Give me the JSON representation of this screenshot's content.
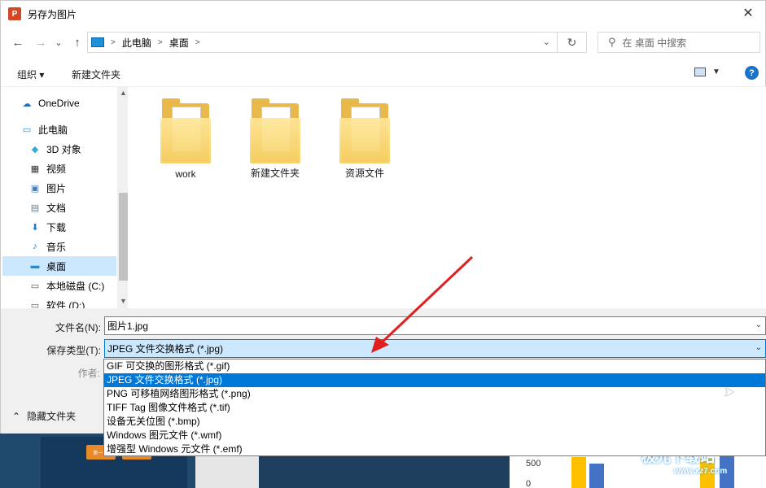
{
  "window": {
    "app_icon": "P",
    "title": "另存为图片",
    "close_icon": "✕"
  },
  "address": {
    "back_icon": "←",
    "forward_icon": "→",
    "history_icon": "⌄",
    "up_icon": "↑",
    "crumbs": [
      "此电脑",
      "桌面"
    ],
    "refresh_icon": "↻",
    "search_placeholder": "在 桌面 中搜索",
    "search_icon": "⚲"
  },
  "toolbar": {
    "organize": "组织 ▾",
    "new_folder": "新建文件夹",
    "help": "?"
  },
  "nav": {
    "items": [
      {
        "label": "OneDrive",
        "icon": "☁",
        "color": "#1e73be"
      },
      {
        "label": "此电脑",
        "icon": "▭",
        "color": "#2a8ad6"
      },
      {
        "label": "3D 对象",
        "icon": "◆",
        "color": "#36a9d8"
      },
      {
        "label": "视频",
        "icon": "▦",
        "color": "#333333"
      },
      {
        "label": "图片",
        "icon": "▣",
        "color": "#4a7fb5"
      },
      {
        "label": "文档",
        "icon": "▤",
        "color": "#6b7c8c"
      },
      {
        "label": "下载",
        "icon": "⬇",
        "color": "#1f78c8"
      },
      {
        "label": "音乐",
        "icon": "♪",
        "color": "#1f78c8"
      },
      {
        "label": "桌面",
        "icon": "▬",
        "color": "#1e8fd8"
      },
      {
        "label": "本地磁盘 (C:)",
        "icon": "▭",
        "color": "#555555"
      },
      {
        "label": "软件 (D:)",
        "icon": "▭",
        "color": "#555555"
      }
    ],
    "selected_index": 8
  },
  "files": [
    {
      "name": "work"
    },
    {
      "name": "新建文件夹"
    },
    {
      "name": "资源文件"
    }
  ],
  "form": {
    "filename_label": "文件名(N):",
    "filename_value": "图片1.jpg",
    "type_label": "保存类型(T):",
    "type_value": "JPEG 文件交换格式 (*.jpg)",
    "author_label": "作者:",
    "dropdown_icon": "⌄"
  },
  "type_options": [
    "GIF 可交换的图形格式 (*.gif)",
    "JPEG 文件交换格式 (*.jpg)",
    "PNG 可移植网络图形格式 (*.png)",
    "TIFF Tag 图像文件格式 (*.tif)",
    "设备无关位图 (*.bmp)",
    "Windows 图元文件 (*.wmf)",
    "增强型 Windows 元文件 (*.emf)"
  ],
  "type_selected_index": 1,
  "hide_folders": {
    "icon": "⌃",
    "label": "隐藏文件夹"
  },
  "background": {
    "step1": "第一步:",
    "step2": "第二",
    "chart_tick_500": "500",
    "chart_tick_0": "0",
    "colors": {
      "orange": "#ffc000",
      "blue": "#4472c4"
    }
  },
  "watermark": {
    "title": "极光下载站",
    "url": "www.xz7.com"
  },
  "colors": {
    "accent": "#0078d7",
    "arrow": "#e02020"
  }
}
